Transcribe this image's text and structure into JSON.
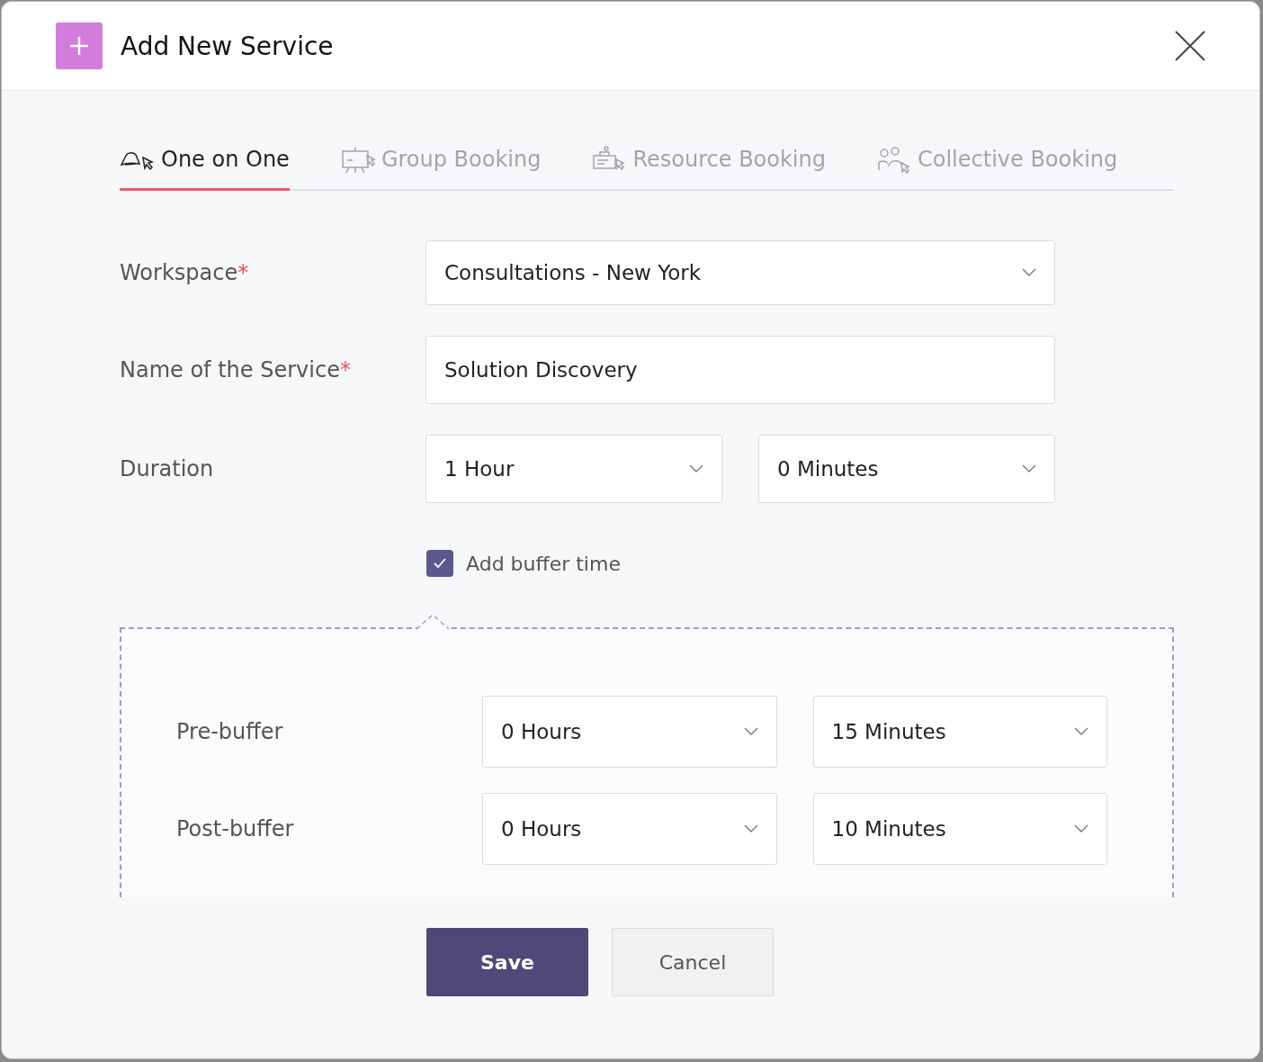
{
  "dialog": {
    "title": "Add New Service"
  },
  "tabs": [
    {
      "label": "One on One",
      "kind": "cap",
      "selected": true
    },
    {
      "label": "Group Booking",
      "kind": "easel",
      "selected": false
    },
    {
      "label": "Resource Booking",
      "kind": "desk",
      "selected": false
    },
    {
      "label": "Collective Booking",
      "kind": "people",
      "selected": false
    }
  ],
  "fields": [
    {
      "label": "Workspace",
      "required_mark": "*",
      "inputs": [
        {
          "kind": "select",
          "value": "Consultations - New York"
        }
      ]
    },
    {
      "label": "Name of the Service",
      "required_mark": "*",
      "inputs": [
        {
          "kind": "text",
          "value": "Solution Discovery"
        }
      ]
    },
    {
      "label": "Duration",
      "inputs": [
        {
          "kind": "select",
          "value": "1 Hour"
        },
        {
          "kind": "select",
          "value": "0 Minutes"
        }
      ]
    }
  ],
  "buffer": {
    "label": "Add buffer time",
    "checked": true,
    "rows": [
      {
        "label": "Pre-buffer",
        "inputs": [
          {
            "kind": "select",
            "value": "0 Hours"
          },
          {
            "kind": "select",
            "value": "15 Minutes"
          }
        ]
      },
      {
        "label": "Post-buffer",
        "inputs": [
          {
            "kind": "select",
            "value": "0 Hours"
          },
          {
            "kind": "select",
            "value": "10 Minutes"
          }
        ]
      }
    ]
  },
  "buttons": [
    {
      "label": "Save",
      "kind": "primary"
    },
    {
      "label": "Cancel",
      "kind": "secondary"
    }
  ]
}
